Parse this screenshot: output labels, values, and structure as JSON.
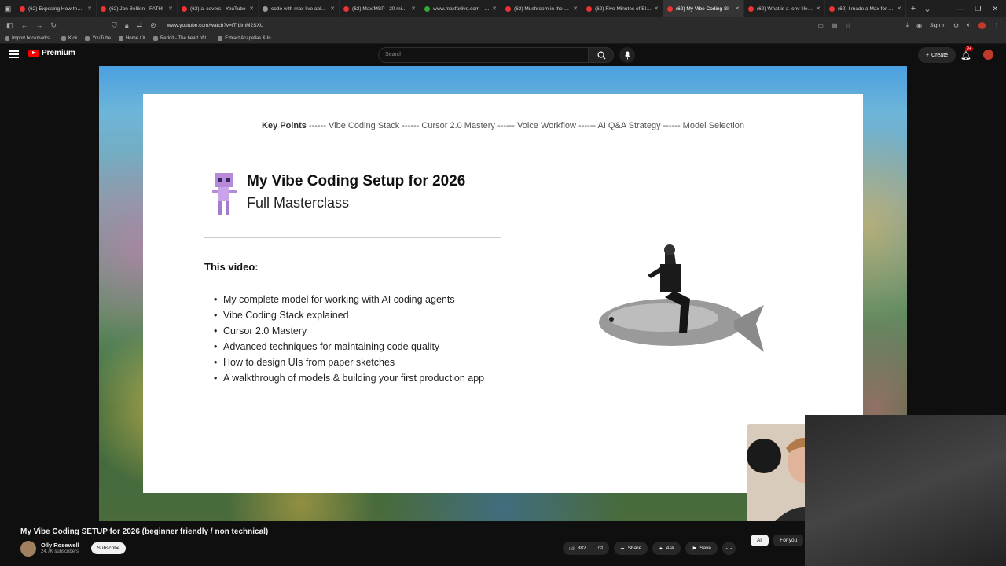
{
  "browser": {
    "tabs": [
      {
        "title": "(62) Exposing How the US C",
        "fav": "red"
      },
      {
        "title": "(62) Jon Bellion - FATHI",
        "fav": "red"
      },
      {
        "title": "(62) ai covers - YouTube",
        "fav": "red"
      },
      {
        "title": "code with max live ableto",
        "fav": "gray"
      },
      {
        "title": "(62) Max/MSP - 20 mins of",
        "fav": "red"
      },
      {
        "title": "www.maxforlive.com - Dow",
        "fav": "green"
      },
      {
        "title": "(62) Mushroom in the Wild",
        "fav": "red"
      },
      {
        "title": "(62) Five Minutes of Blue O",
        "fav": "red"
      },
      {
        "title": "(62) My Vibe Coding Sl",
        "fav": "red",
        "active": true
      },
      {
        "title": "(62) What is a .env file? - Yo",
        "fav": "red"
      },
      {
        "title": "(62) I made a Max for Live d",
        "fav": "red"
      }
    ],
    "url": "www.youtube.com/watch?v=fTrblmM2SXU",
    "signin": "Sign in",
    "bookmarks": [
      "Import bookmarks...",
      "Kick",
      "YouTube",
      "Home / X",
      "Reddit - The heart of t...",
      "Extract Acapellas & In..."
    ]
  },
  "yt": {
    "logo": "Premium",
    "search_placeholder": "Search",
    "create": "Create",
    "notif_count": "9+"
  },
  "slide": {
    "key_label": "Key Points",
    "key_rest": " ------ Vibe Coding Stack ------ Cursor 2.0 Mastery ------ Voice Workflow ------ AI Q&A Strategy ------ Model Selection",
    "title": "My Vibe Coding Setup for 2026",
    "subtitle": "Full Masterclass",
    "section": "This video:",
    "bullets": [
      "My complete model for working with AI coding agents",
      "Vibe Coding Stack explained",
      "Cursor 2.0 Mastery",
      "Advanced techniques for maintaining code quality",
      "How to design UIs from paper sketches",
      "A walkthrough of models & building your first production app"
    ]
  },
  "video": {
    "title": "My Vibe Coding SETUP for 2026 (beginner friendly / non technical)",
    "channel": "Olly Rosewell",
    "subscribers": "24.7K subscribers",
    "subscribe": "Subscribe",
    "likes": "382",
    "share": "Share",
    "ask": "Ask",
    "save": "Save"
  },
  "chips": [
    "All",
    "For you"
  ]
}
